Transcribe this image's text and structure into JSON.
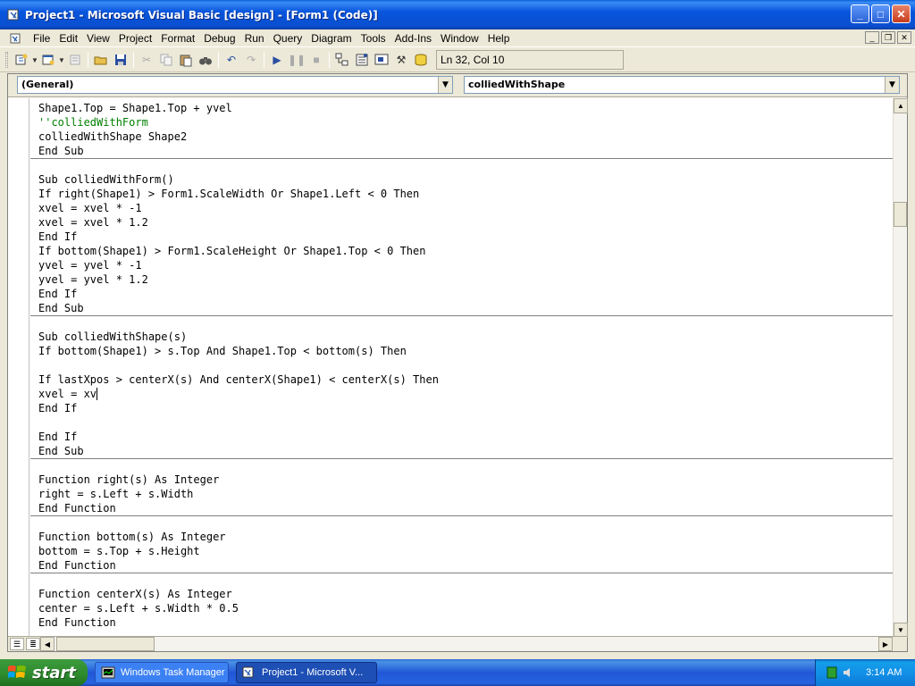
{
  "window": {
    "title": "Project1 - Microsoft Visual Basic [design] - [Form1 (Code)]",
    "controls": [
      "_",
      "□",
      "✕"
    ]
  },
  "menu": [
    "File",
    "Edit",
    "View",
    "Project",
    "Format",
    "Debug",
    "Run",
    "Query",
    "Diagram",
    "Tools",
    "Add-Ins",
    "Window",
    "Help"
  ],
  "toolbar": {
    "position": "Ln 32, Col 10"
  },
  "combos": {
    "object": "(General)",
    "procedure": "colliedWithShape"
  },
  "code_blocks": [
    [
      "Shape1.Top = Shape1.Top + yvel",
      "''colliedWithForm",
      "colliedWithShape Shape2",
      "End Sub"
    ],
    [
      "Sub colliedWithForm()",
      "If right(Shape1) > Form1.ScaleWidth Or Shape1.Left < 0 Then",
      "xvel = xvel * -1",
      "xvel = xvel * 1.2",
      "End If",
      "If bottom(Shape1) > Form1.ScaleHeight Or Shape1.Top < 0 Then",
      "yvel = yvel * -1",
      "yvel = yvel * 1.2",
      "End If",
      "End Sub"
    ],
    [
      "Sub colliedWithShape(s)",
      "If bottom(Shape1) > s.Top And Shape1.Top < bottom(s) Then",
      "",
      "If lastXpos > centerX(s) And centerX(Shape1) < centerX(s) Then",
      "xvel = xv",
      "End If",
      "",
      "End If",
      "End Sub"
    ],
    [
      "Function right(s) As Integer",
      "right = s.Left + s.Width",
      "End Function"
    ],
    [
      "Function bottom(s) As Integer",
      "bottom = s.Top + s.Height",
      "End Function"
    ],
    [
      "Function centerX(s) As Integer",
      "center = s.Left + s.Width * 0.5",
      "End Function"
    ]
  ],
  "taskbar": {
    "start": "start",
    "items": [
      "Windows Task Manager",
      "Project1 - Microsoft V..."
    ],
    "clock": "3:14 AM"
  }
}
